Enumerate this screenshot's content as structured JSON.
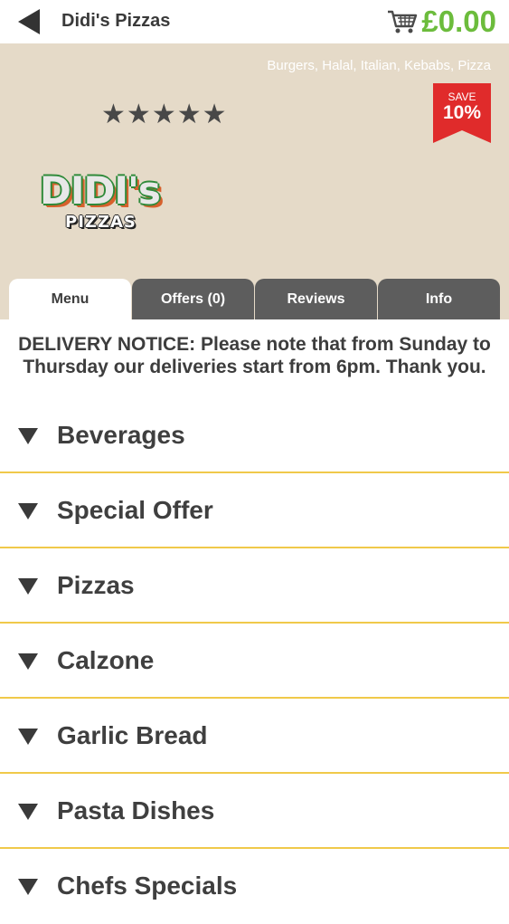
{
  "header": {
    "back_icon": "back-arrow-icon",
    "title": "Didi's Pizzas",
    "cart_icon": "shopping-cart-icon",
    "cart_total": "£0.00",
    "cart_total_color": "#6cbc3c"
  },
  "hero": {
    "background_color": "#e5dac8",
    "cuisines": "Burgers, Halal, Italian, Kebabs, Pizza",
    "rating_stars": 5,
    "rating_glyph": "★",
    "save_badge": {
      "label": "SAVE",
      "percent": "10%",
      "color": "#e02b2b"
    },
    "logo": {
      "top": "DIDI's",
      "bottom": "PIZZAS"
    }
  },
  "tabs": [
    {
      "label": "Menu",
      "active": true
    },
    {
      "label": "Offers (0)",
      "active": false
    },
    {
      "label": "Reviews",
      "active": false
    },
    {
      "label": "Info",
      "active": false
    }
  ],
  "notice": "DELIVERY NOTICE: Please note that from Sunday to Thursday our deliveries start from 6pm. Thank you.",
  "menu": {
    "expand_icon": "triangle-down-icon",
    "categories": [
      "Beverages",
      "Special Offer",
      "Pizzas",
      "Calzone",
      "Garlic Bread",
      "Pasta Dishes",
      "Chefs Specials"
    ]
  }
}
